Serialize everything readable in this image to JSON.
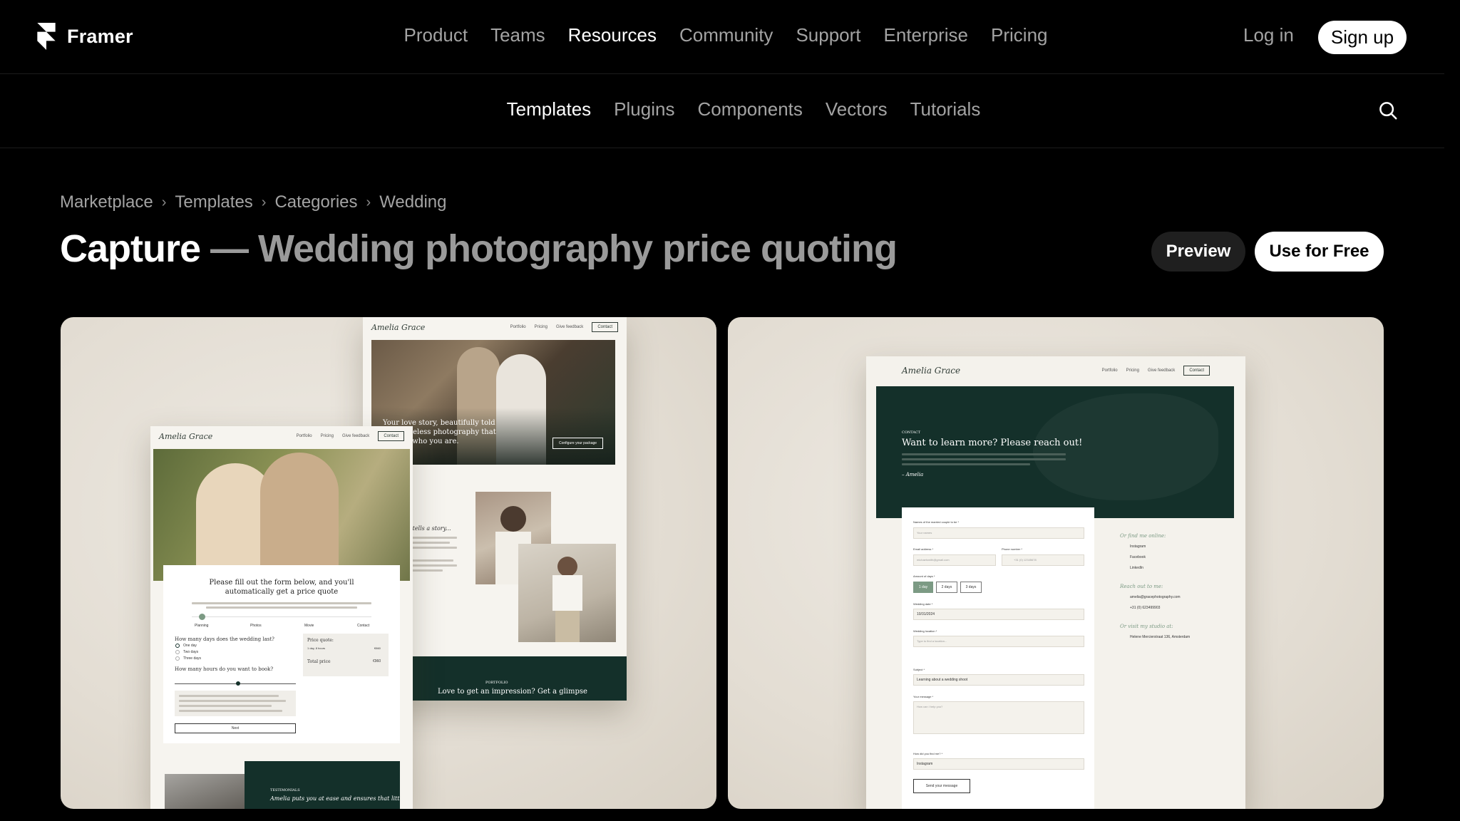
{
  "brand": {
    "name": "Framer"
  },
  "nav": {
    "items": [
      {
        "label": "Product",
        "active": false
      },
      {
        "label": "Teams",
        "active": false
      },
      {
        "label": "Resources",
        "active": true
      },
      {
        "label": "Community",
        "active": false
      },
      {
        "label": "Support",
        "active": false
      },
      {
        "label": "Enterprise",
        "active": false
      },
      {
        "label": "Pricing",
        "active": false
      }
    ],
    "login": "Log in",
    "signup": "Sign up"
  },
  "subnav": {
    "items": [
      {
        "label": "Templates",
        "active": true
      },
      {
        "label": "Plugins",
        "active": false
      },
      {
        "label": "Components",
        "active": false
      },
      {
        "label": "Vectors",
        "active": false
      },
      {
        "label": "Tutorials",
        "active": false
      }
    ]
  },
  "breadcrumb": [
    "Marketplace",
    "Templates",
    "Categories",
    "Wedding"
  ],
  "title": {
    "name": "Capture",
    "dash": " — ",
    "subtitle": "Wedding photography price quoting"
  },
  "actions": {
    "preview": "Preview",
    "use_free": "Use for Free"
  },
  "preview1": {
    "logo": "Amelia Grace",
    "nav_links": [
      "Portfolio",
      "Pricing",
      "Give feedback"
    ],
    "contact": "Contact",
    "hero_text": "Your love story, beautifully told with timeless photography that reflects who you are.",
    "hero_cta": "Configure your package",
    "story_heading": "Every picture tells a story...",
    "portfolio_tag": "PORTFOLIO",
    "portfolio_text": "Love to get an impression? Get a glimpse",
    "quote_heading": "Please fill out the form below, and you'll automatically get a price quote",
    "steps": [
      "Planning",
      "Photos",
      "Movie",
      "Contact"
    ],
    "q_days": "How many days does the wedding last?",
    "day_options": [
      "One day",
      "Two days",
      "Three days"
    ],
    "q_hours": "How many hours do you want to book?",
    "price_title": "Price quote:",
    "price_line": "1 day, 8 hours",
    "price_line_val": "€860",
    "total_label": "Total price",
    "total_val": "€960",
    "next": "Next",
    "testimonial_tag": "TESTIMONIALS",
    "testimonial_text": "Amelia puts you at ease and ensures that little"
  },
  "preview2": {
    "logo": "Amelia Grace",
    "nav_links": [
      "Portfolio",
      "Pricing",
      "Give feedback"
    ],
    "contact": "Contact",
    "tag": "CONTACT",
    "heading": "Want to learn more? Please reach out!",
    "signature": "– Amelia",
    "labels": [
      "Names of the married couple to be *",
      "Email address *",
      "Phone number *",
      "Amount of days *",
      "Wedding date *",
      "Wedding location *",
      "Subject *",
      "Your message *",
      "How did you find me? *"
    ],
    "placeholders": [
      "Your names",
      "michaelsmith@gmail.com",
      "+31 (0) 12345678",
      "Type to find a location...",
      "How can I help you?"
    ],
    "day_options": [
      "1 day",
      "2 days",
      "3 days"
    ],
    "date_value": "10/31/2024",
    "subject_value": "Learning about a wedding shoot",
    "found_value": "Instagram",
    "send": "Send your message",
    "social_title": "Or find me online:",
    "socials": [
      "Instagram",
      "Facebook",
      "LinkedIn"
    ],
    "reach_title": "Reach out to me:",
    "email": "amelia@gracephotography.com",
    "phone": "+31 (0) 623499903",
    "visit_title": "Or visit my studio at:",
    "address": "Helene Mercierstraat 136, Amsterdam"
  }
}
